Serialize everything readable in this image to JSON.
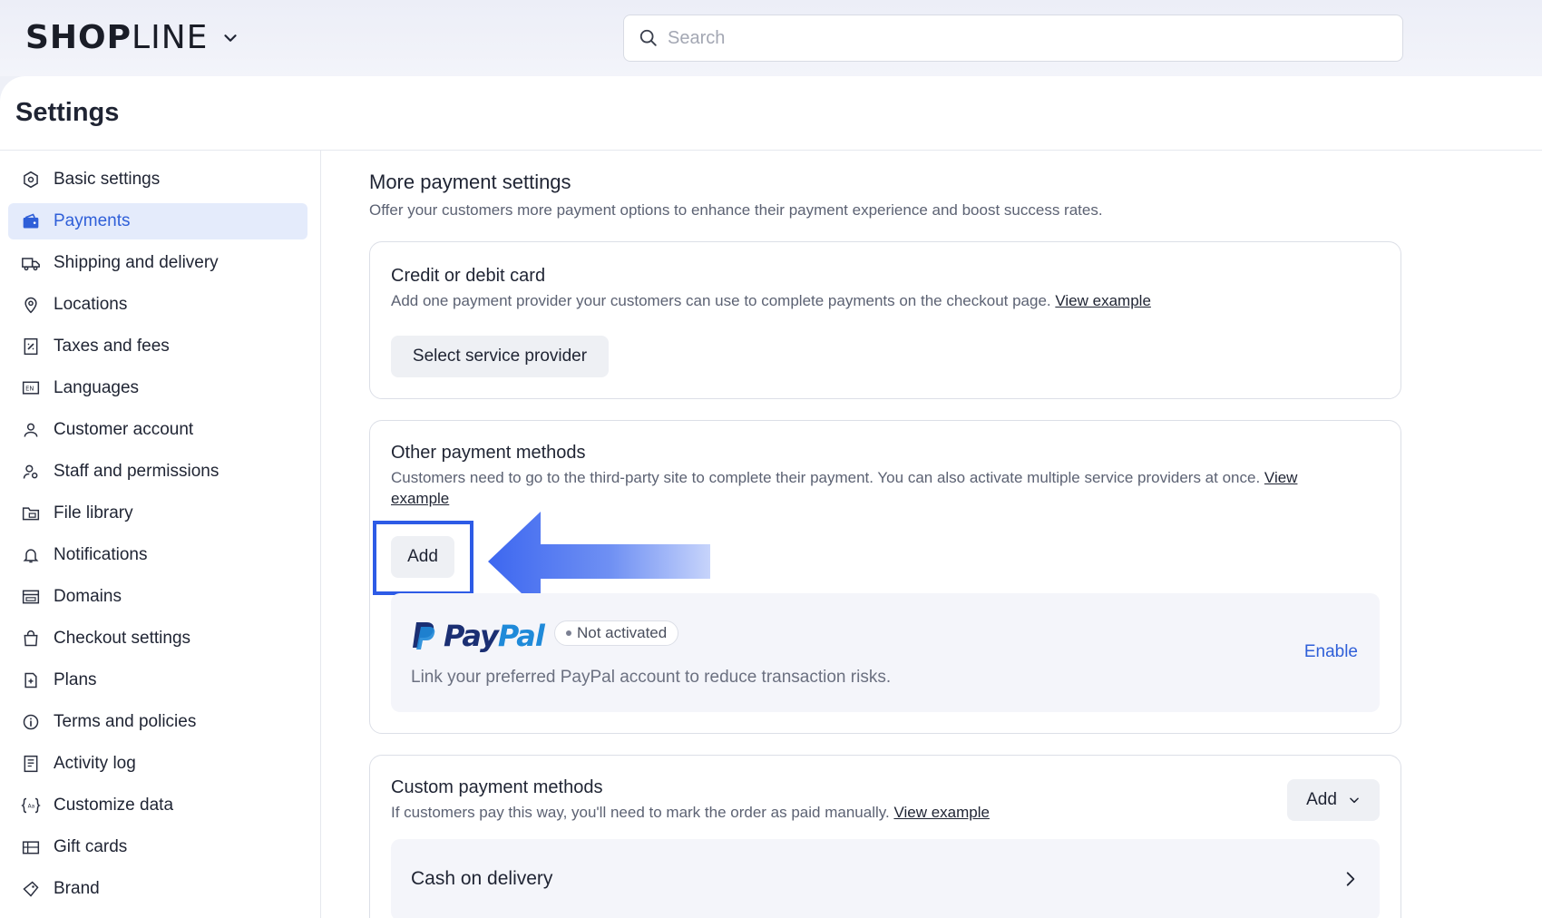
{
  "app": {
    "logo_text_bold": "SHOP",
    "logo_text_light": "LINE"
  },
  "search": {
    "placeholder": "Search"
  },
  "page": {
    "title": "Settings"
  },
  "sidebar": {
    "items": [
      {
        "label": "Basic settings",
        "icon": "gear-hex-icon",
        "active": false
      },
      {
        "label": "Payments",
        "icon": "wallet-icon",
        "active": true
      },
      {
        "label": "Shipping and delivery",
        "icon": "truck-icon",
        "active": false
      },
      {
        "label": "Locations",
        "icon": "location-pin-icon",
        "active": false
      },
      {
        "label": "Taxes and fees",
        "icon": "receipt-icon",
        "active": false
      },
      {
        "label": "Languages",
        "icon": "language-icon",
        "active": false
      },
      {
        "label": "Customer account",
        "icon": "user-icon",
        "active": false
      },
      {
        "label": "Staff and permissions",
        "icon": "user-gear-icon",
        "active": false
      },
      {
        "label": "File library",
        "icon": "folder-icon",
        "active": false
      },
      {
        "label": "Notifications",
        "icon": "bell-icon",
        "active": false
      },
      {
        "label": "Domains",
        "icon": "domain-icon",
        "active": false
      },
      {
        "label": "Checkout settings",
        "icon": "bag-icon",
        "active": false
      },
      {
        "label": "Plans",
        "icon": "plan-icon",
        "active": false
      },
      {
        "label": "Terms and policies",
        "icon": "info-icon",
        "active": false
      },
      {
        "label": "Activity log",
        "icon": "log-icon",
        "active": false
      },
      {
        "label": "Customize data",
        "icon": "code-braces-icon",
        "active": false
      },
      {
        "label": "Gift cards",
        "icon": "gift-card-icon",
        "active": false
      },
      {
        "label": "Brand",
        "icon": "brand-icon",
        "active": false
      }
    ]
  },
  "main": {
    "section_title": "More payment settings",
    "section_desc": "Offer your customers more payment options to enhance their payment experience and boost success rates.",
    "credit_card": {
      "title": "Credit or debit card",
      "desc": "Add one payment provider your customers can use to complete payments on the checkout page.",
      "link": "View example",
      "button": "Select service provider"
    },
    "other_methods": {
      "title": "Other payment methods",
      "desc": "Customers need to go to the third-party site to complete their payment. You can also activate multiple service providers at once.",
      "link_part1": "View",
      "link_part2": "example",
      "add_button": "Add",
      "paypal": {
        "logo_pay": "Pay",
        "logo_pal": "Pal",
        "status": "Not activated",
        "desc": "Link your preferred PayPal account to reduce transaction risks.",
        "action": "Enable"
      }
    },
    "custom_methods": {
      "title": "Custom payment methods",
      "desc": "If customers pay this way, you'll need to mark the order as paid manually.",
      "link": "View example",
      "add_button": "Add",
      "items": [
        {
          "label": "Cash on delivery"
        }
      ]
    }
  },
  "colors": {
    "accent": "#2f5fd8",
    "highlight": "#2d5be6",
    "paypal_dark": "#1b2f73",
    "paypal_light": "#1f8ad9"
  }
}
